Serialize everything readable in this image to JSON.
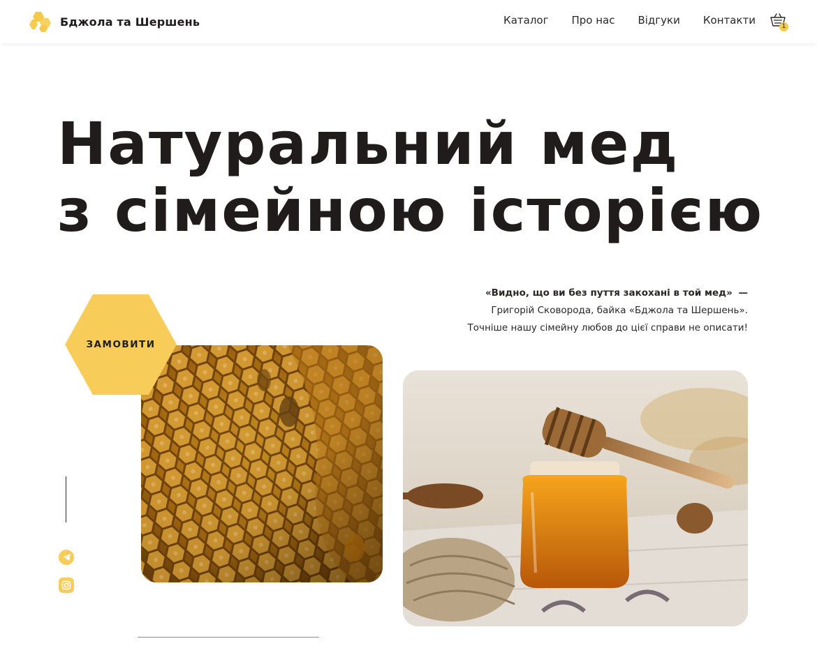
{
  "header": {
    "brand": "Бджола та Шершень",
    "nav": [
      "Каталог",
      "Про нас",
      "Відгуки",
      "Контакти"
    ],
    "cart_count": "1",
    "accent_color": "#f7c948"
  },
  "hero": {
    "title_line1": "Натуральний мед",
    "title_line2": "з сімейною історією",
    "quote_line1": "«Видно, що ви без пуття закохані в той мед»",
    "quote_dash": "—",
    "quote_line2": "Григорій Сковорода, байка «Бджола та Шершень».",
    "quote_line3": "Точніше нашу сімейну любов до цієї справи не описати!",
    "order_button": "ЗАМОВИТИ"
  },
  "icons": {
    "logo": "honeycomb-logo-icon",
    "cart": "shopping-basket-icon",
    "social": [
      "telegram-icon",
      "instagram-icon"
    ]
  }
}
